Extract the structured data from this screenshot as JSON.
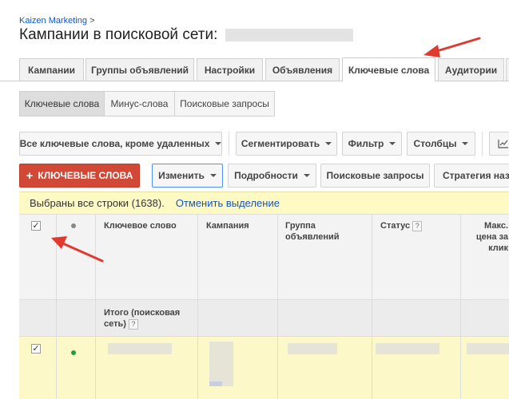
{
  "header": {
    "breadcrumb": "Kaizen Marketing",
    "breadcrumb_sep": ">",
    "title": "Кампании в поисковой сети:"
  },
  "tabs": [
    {
      "label": "Кампании"
    },
    {
      "label": "Группы объявлений"
    },
    {
      "label": "Настройки"
    },
    {
      "label": "Объявления"
    },
    {
      "label": "Ключевые слова",
      "active": true
    },
    {
      "label": "Аудитории"
    }
  ],
  "subtabs": [
    {
      "label": "Ключевые слова",
      "active": true
    },
    {
      "label": "Минус-слова"
    },
    {
      "label": "Поисковые запросы"
    }
  ],
  "toolbar1": {
    "filter_all": "Все ключевые слова, кроме удаленных",
    "segment": "Сегментировать",
    "filter": "Фильтр",
    "columns": "Столбцы"
  },
  "toolbar2": {
    "add_keywords": "КЛЮЧЕВЫЕ СЛОВА",
    "edit": "Изменить",
    "details": "Подробности",
    "search_terms": "Поисковые запросы",
    "strategy": "Стратегия назн"
  },
  "banner": {
    "text": "Выбраны все строки (1638).",
    "cancel_link": "Отменить выделение"
  },
  "table": {
    "headers": {
      "keyword": "Ключевое слово",
      "campaign": "Кампания",
      "ad_group": "Группа объявлений",
      "status": "Статус",
      "max_cpc": "Макс. цена за клик"
    },
    "total_label": "Итого (поисковая сеть)",
    "help_glyph": "?",
    "check_glyph": "✓"
  },
  "colors": {
    "red_button": "#d14836",
    "link": "#1155cc",
    "banner_bg": "#fff9c4",
    "annotation_arrow": "#e03a2f",
    "status_dot_green": "#1e9e3a"
  },
  "icons": [
    "plus-icon",
    "chart-icon",
    "caret-down-icon",
    "checkbox-icon",
    "status-dot-icon",
    "help-icon",
    "red-arrow-annotation"
  ]
}
